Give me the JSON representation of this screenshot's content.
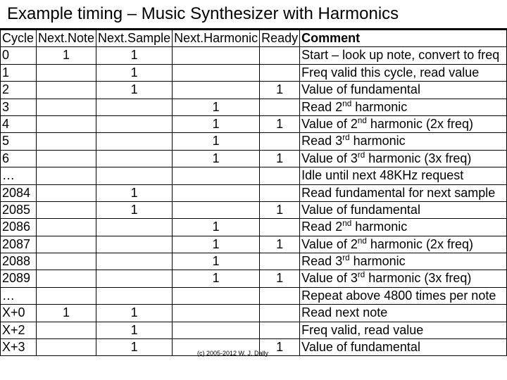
{
  "title": "Example timing – Music Synthesizer with Harmonics",
  "headers": {
    "cycle": "Cycle",
    "note": "Next.Note",
    "sample": "Next.Sample",
    "harmonic": "Next.Harmonic",
    "ready": "Ready",
    "comment": "Comment"
  },
  "rows": [
    {
      "cycle": "0",
      "note": "1",
      "sample": "1",
      "harm": "",
      "ready": "",
      "comment_html": "Start – look up note, convert to freq"
    },
    {
      "cycle": "1",
      "note": "",
      "sample": "1",
      "harm": "",
      "ready": "",
      "comment_html": "Freq valid this cycle, read value"
    },
    {
      "cycle": "2",
      "note": "",
      "sample": "1",
      "harm": "",
      "ready": "1",
      "comment_html": "Value of fundamental"
    },
    {
      "cycle": "3",
      "note": "",
      "sample": "",
      "harm": "1",
      "ready": "",
      "comment_html": "Read 2<sup>nd</sup> harmonic"
    },
    {
      "cycle": "4",
      "note": "",
      "sample": "",
      "harm": "1",
      "ready": "1",
      "comment_html": "Value of 2<sup>nd</sup> harmonic (2x freq)"
    },
    {
      "cycle": "5",
      "note": "",
      "sample": "",
      "harm": "1",
      "ready": "",
      "comment_html": "Read 3<sup>rd</sup> harmonic"
    },
    {
      "cycle": "6",
      "note": "",
      "sample": "",
      "harm": "1",
      "ready": "1",
      "comment_html": "Value of 3<sup>rd</sup> harmonic (3x freq)"
    },
    {
      "cycle": "…",
      "note": "",
      "sample": "",
      "harm": "",
      "ready": "",
      "comment_html": "Idle until next 48KHz request"
    },
    {
      "cycle": "2084",
      "note": "",
      "sample": "1",
      "harm": "",
      "ready": "",
      "comment_html": "Read fundamental for next sample"
    },
    {
      "cycle": "2085",
      "note": "",
      "sample": "1",
      "harm": "",
      "ready": "1",
      "comment_html": "Value of fundamental"
    },
    {
      "cycle": "2086",
      "note": "",
      "sample": "",
      "harm": "1",
      "ready": "",
      "comment_html": "Read 2<sup>nd</sup> harmonic"
    },
    {
      "cycle": "2087",
      "note": "",
      "sample": "",
      "harm": "1",
      "ready": "1",
      "comment_html": "Value of 2<sup>nd</sup> harmonic (2x freq)"
    },
    {
      "cycle": "2088",
      "note": "",
      "sample": "",
      "harm": "1",
      "ready": "",
      "comment_html": "Read 3<sup>rd</sup> harmonic"
    },
    {
      "cycle": "2089",
      "note": "",
      "sample": "",
      "harm": "1",
      "ready": "1",
      "comment_html": "Value of 3<sup>rd</sup> harmonic (3x freq)"
    },
    {
      "cycle": "…",
      "note": "",
      "sample": "",
      "harm": "",
      "ready": "",
      "comment_html": "Repeat above 4800 times per note"
    },
    {
      "cycle": "X+0",
      "note": "1",
      "sample": "1",
      "harm": "",
      "ready": "",
      "comment_html": "Read next note"
    },
    {
      "cycle": "X+2",
      "note": "",
      "sample": "1",
      "harm": "",
      "ready": "",
      "comment_html": "Freq valid, read value"
    },
    {
      "cycle": "X+3",
      "note": "",
      "sample": "1",
      "harm": "",
      "ready": "1",
      "comment_html": "Value of fundamental"
    }
  ],
  "footer": "(c) 2005-2012 W. J. Dally"
}
